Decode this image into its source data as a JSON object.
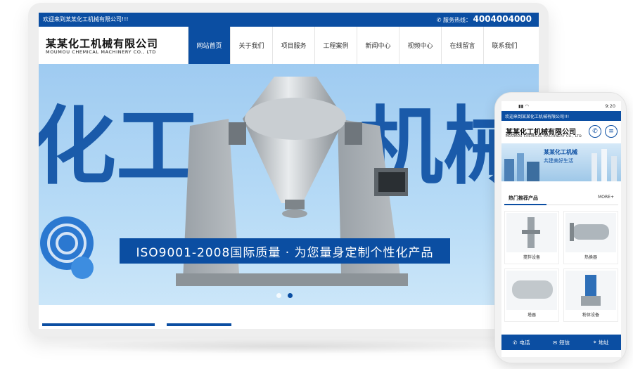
{
  "desktop": {
    "topbar": {
      "welcome": "欢迎来到某某化工机械有限公司!!!",
      "hotline_label": "服务热线：",
      "hotline_number": "4004004000"
    },
    "logo": {
      "cn": "某某化工机械有限公司",
      "en": "MOUMOU CHEMICAL MACHINERY CO., LTD"
    },
    "nav": [
      "网站首页",
      "关于我们",
      "项目服务",
      "工程案例",
      "新闻中心",
      "视频中心",
      "在线留言",
      "联系我们"
    ],
    "nav_active_index": 0,
    "banner": {
      "big_left": "化工",
      "big_right": "机械",
      "slogan": "ISO9001-2008国际质量 · 为您量身定制个性化产品",
      "slide_count": 2,
      "active_slide": 2
    }
  },
  "mobile": {
    "status": {
      "time": "9:20"
    },
    "topbar": {
      "welcome": "欢迎来到某某化工机械有限公司!!!"
    },
    "logo": {
      "cn": "某某化工机械有限公司",
      "en": "MOUMOU CHEMICAL MACHINERY CO., LTD"
    },
    "banner": {
      "line1": "某某化工机械",
      "line2": "共建美好生活"
    },
    "section": {
      "title": "热门推荐产品",
      "more": "MORE+"
    },
    "products": [
      {
        "name": "搅拌设备",
        "icon": "mixer-icon"
      },
      {
        "name": "热换器",
        "icon": "heat-exchanger-icon"
      },
      {
        "name": "塔器",
        "icon": "tower-vessel-icon"
      },
      {
        "name": "粉体设备",
        "icon": "powder-equipment-icon"
      }
    ],
    "footer": [
      {
        "label": "电话",
        "icon": "phone-icon"
      },
      {
        "label": "短信",
        "icon": "message-icon"
      },
      {
        "label": "地址",
        "icon": "location-icon"
      }
    ]
  },
  "colors": {
    "brand": "#0b4ea2",
    "banner_sky": "#9fcbf1"
  }
}
